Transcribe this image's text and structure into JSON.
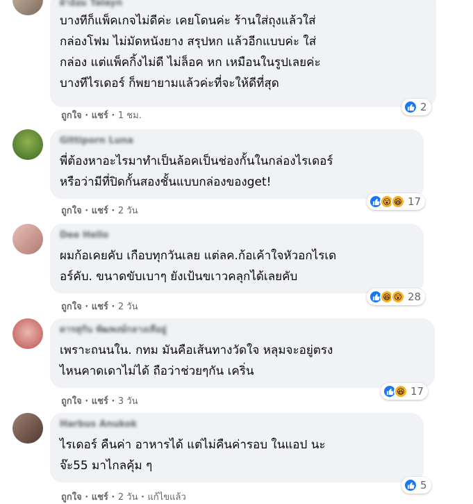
{
  "colors": {
    "like_blue": "#1877f2",
    "emoji_yellow": "#f7b125",
    "bubble_bg": "#f0f2f5",
    "meta_gray": "#65676b"
  },
  "comments": [
    {
      "author": "ผ้าอ้อม Talayn",
      "text": "บางทีก็แพ็คเกจไม่ดีค่ะ เคยโดนค่ะ ร้านใส่ถุงแล้วใส่\nกล่องโฟม ไม่มัดหนังยาง สรุปหก แล้วอีกแบบค่ะ ใส่\nกล่อง แต่แพ็คกิ้งไม่ดี ไม่ล็อค หก เหมือนในรูปเลยค่ะ\nบางทีไรเดอร์ ก็พยายามแล้วค่ะที่จะให้ดีที่สุด",
      "like": "ถูกใจ",
      "share": "แชร์",
      "time": "1 ชม.",
      "edited": "",
      "reactions": [
        "like-icon"
      ],
      "count": "2"
    },
    {
      "author": "Gittiporn Luna",
      "text": "พี่ต้องหาอะไรมาทำเป็นล้อคเป็นช่องกั้นในกล่องไรเดอร์\nหรือว่ามีที่ปิดกั้นสองชั้นแบบกล่องของget!",
      "like": "ถูกใจ",
      "share": "แชร์",
      "time": "2 วัน",
      "edited": "",
      "reactions": [
        "like-icon",
        "wow-icon",
        "haha-icon"
      ],
      "count": "17"
    },
    {
      "author": "Dee Hello",
      "text": "ผมก้อเคยคับ เกือบทุกวันเลย แต่ลค.ก้อเค้าใจหัวอกไรเด\nอร์คับ. ขนาดขับเบาๆ ยังเป้นขเาวคลุกได้เลยคับ",
      "like": "ถูกใจ",
      "share": "แชร์",
      "time": "2 วัน",
      "edited": "",
      "reactions": [
        "like-icon",
        "haha-icon",
        "wow-icon"
      ],
      "count": "28"
    },
    {
      "author": "ดารสุกัน พัฒพงษ์กลางเทือยู่",
      "text": "เพราะถนนใน. กทม มันคือเส้นทางวัดใจ หลุมจะอยู่ตรง\nไหนคาดเดาไม่ได้ ถือว่าช่วยๆกัน เคริ่น",
      "like": "ถูกใจ",
      "share": "แชร์",
      "time": "3 วัน",
      "edited": "",
      "reactions": [
        "like-icon",
        "haha-icon"
      ],
      "count": "17"
    },
    {
      "author": "Harbus Anukok",
      "text": "ไรเดอร์ คืนค่า อาหารได้ แต่ไม่คืนค่ารอบ ในแอป นะ\nจ๊ะ55 มาไกลคุ้ม ๆ",
      "like": "ถูกใจ",
      "share": "แชร์",
      "time": "2 วัน",
      "edited": "แก้ไขแล้ว",
      "reactions": [
        "like-icon"
      ],
      "count": "5"
    }
  ]
}
